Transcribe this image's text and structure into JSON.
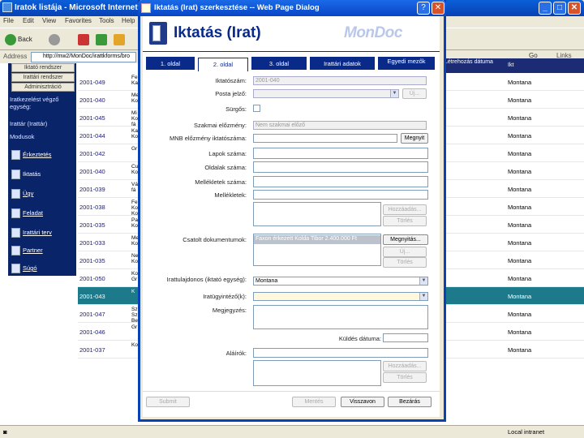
{
  "bg_window": {
    "title": "Iratok listája - Microsoft Internet Ex",
    "menu": [
      "File",
      "Edit",
      "View",
      "Favorites",
      "Tools",
      "Help"
    ],
    "toolbar": {
      "back": "Back",
      "forward": "",
      "stop": "",
      "refresh": "",
      "home": ""
    },
    "address_label": "Address",
    "address_value": "http://mw2/MonDoc/irattkforms/bro",
    "go_label": "Go",
    "links_label": "Links"
  },
  "sidebar": {
    "top_buttons": [
      "Iktató rendszer",
      "Irattári rendszer",
      "Adminisztráció"
    ],
    "texts": [
      "Iratkezelést végző egység:",
      "Irattár (Irattár)",
      "Modusok"
    ],
    "items": [
      "Érkeztetés",
      "Iktatás",
      "Ügy",
      "Feladat",
      "Irattári terv",
      "Partner",
      "Súgó"
    ]
  },
  "table": {
    "header_right": [
      "Létrehozás dátuma",
      "Ikt",
      "Ügyintéző"
    ],
    "rows": [
      {
        "id": "2001-049",
        "c2": "Fe Kar",
        "c3": "Montana",
        "selected": false
      },
      {
        "id": "2001-040",
        "c2": "Me Ko",
        "c3": "Montana",
        "selected": false
      },
      {
        "id": "2001-045",
        "c2": "Mi Ko fá",
        "c3": "Montana",
        "selected": false
      },
      {
        "id": "2001-044",
        "c2": "Ka Ko",
        "c3": "Montana",
        "selected": false
      },
      {
        "id": "2001-042",
        "c2": "Gr",
        "c3": "Montana",
        "selected": false
      },
      {
        "id": "2001-040",
        "c2": "Cu Ko",
        "c3": "Montana",
        "selected": false
      },
      {
        "id": "2001-039",
        "c2": "Vá fá",
        "c3": "Montana",
        "selected": false
      },
      {
        "id": "2001-038",
        "c2": "Fe Ko Ko",
        "c3": "Montana",
        "selected": false
      },
      {
        "id": "2001-035",
        "c2": "Pa Ko",
        "c3": "Montana",
        "selected": false
      },
      {
        "id": "2001-033",
        "c2": "Me Ko",
        "c3": "Montana",
        "selected": false
      },
      {
        "id": "2001-035",
        "c2": "Ne Ko",
        "c3": "Montana",
        "selected": false
      },
      {
        "id": "2001-050",
        "c2": "Ko Gr",
        "c3": "Montana",
        "selected": false
      },
      {
        "id": "2001-043",
        "c2": "K",
        "c3": "Montana",
        "selected": true
      },
      {
        "id": "2001-047",
        "c2": "Sz Sz Be Mi",
        "c3": "Montana",
        "selected": false
      },
      {
        "id": "2001-046",
        "c2": "Gr",
        "c3": "Montana",
        "selected": false
      },
      {
        "id": "2001-037",
        "c2": "Ko",
        "c3": "Montana",
        "selected": false
      }
    ]
  },
  "status_bar": {
    "zone": "Local intranet"
  },
  "dialog": {
    "title": "Iktatás (Irat) szerkesztése -- Web Page Dialog",
    "help": "?",
    "close": "✕",
    "banner_title": "Iktatás (Irat)",
    "logo": "MonDoc",
    "tabs": [
      "1. oldal",
      "2. oldal",
      "3. oldal",
      "Irattári adatok",
      "Egyedi mezők"
    ],
    "active_tab": 1,
    "fields": {
      "iktatoszam_label": "Iktatószám:",
      "iktatoszam_value": "2001-040",
      "postajelzo_label": "Posta jelző:",
      "postajelzo_btn": "Új...",
      "surgos_label": "Sürgős:",
      "szakmai_label": "Szakmai előzmény:",
      "szakmai_value": "Nem szakmai előző",
      "mnb_label": "MNB előzmény iktatószáma:",
      "mnb_btn": "Megnyit",
      "lapok_label": "Lapok száma:",
      "oldalak_label": "Oldalak száma:",
      "mellekletek_szama_label": "Mellékletek száma:",
      "mellekletek_label": "Mellékletek:",
      "hozzaadas_btn": "Hozzáadás...",
      "torles_btn": "Törlés",
      "csatolt_label": "Csatolt dokumentumok:",
      "csatolt_value": "Faxon érkezett Kolda Tibor 2.400.000 Ft",
      "megnyitas_btn": "Megnyitás...",
      "uj_btn": "Új...",
      "torles2_btn": "Törlés",
      "irattulajdonos_label": "Irattulajdonos (iktató egység):",
      "irattulajdonos_value": "Montana",
      "ugyintezo_label": "Iratügyintéző(k):",
      "megjegyzes_label": "Megjegyzés:",
      "kuldes_label": "Küldés dátuma:",
      "alairok_label": "Aláírók:",
      "hozzaadas2_btn": "Hozzáadás...",
      "torles3_btn": "Törlés"
    },
    "footer": {
      "submit": "Submit",
      "mentes": "Mentés",
      "visszavon": "Visszavon",
      "bezaras": "Bezárás"
    }
  }
}
